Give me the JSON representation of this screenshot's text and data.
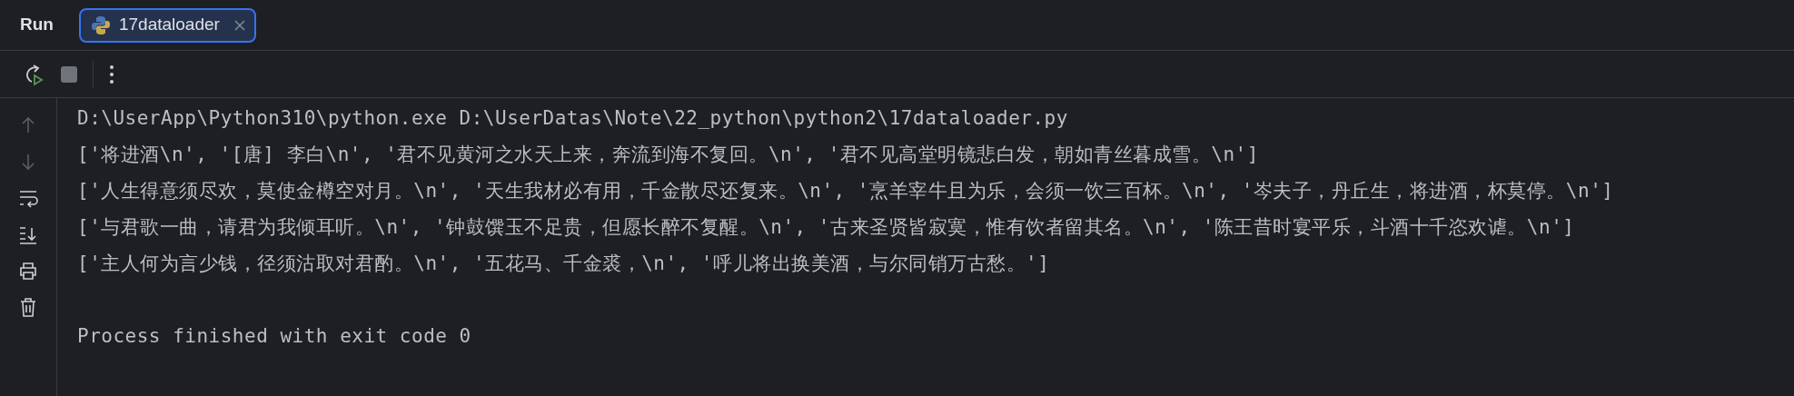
{
  "tool_window": {
    "title": "Run"
  },
  "tabs": [
    {
      "label": "17dataloader",
      "selected": true
    }
  ],
  "gutter_buttons": [
    {
      "kind": "up",
      "disabled": true
    },
    {
      "kind": "down",
      "disabled": true
    },
    {
      "kind": "wrap",
      "disabled": false
    },
    {
      "kind": "scroll-end",
      "disabled": false
    },
    {
      "kind": "print",
      "disabled": false
    },
    {
      "kind": "trash",
      "disabled": false
    }
  ],
  "console": {
    "lines": [
      "D:\\UserApp\\Python310\\python.exe D:\\UserDatas\\Note\\22_python\\python2\\17dataloader.py",
      "['将进酒\\n', '[唐] 李白\\n', '君不见黄河之水天上来，奔流到海不复回。\\n', '君不见高堂明镜悲白发，朝如青丝暮成雪。\\n']",
      "['人生得意须尽欢，莫使金樽空对月。\\n', '天生我材必有用，千金散尽还复来。\\n', '烹羊宰牛且为乐，会须一饮三百杯。\\n', '岑夫子，丹丘生，将进酒，杯莫停。\\n']",
      "['与君歌一曲，请君为我倾耳听。\\n', '钟鼓馔玉不足贵，但愿长醉不复醒。\\n', '古来圣贤皆寂寞，惟有饮者留其名。\\n', '陈王昔时宴平乐，斗酒十千恣欢谑。\\n']",
      "['主人何为言少钱，径须沽取对君酌。\\n', '五花马、千金裘，\\n', '呼儿将出换美酒，与尔同销万古愁。']"
    ],
    "exit_message": "Process finished with exit code 0"
  }
}
